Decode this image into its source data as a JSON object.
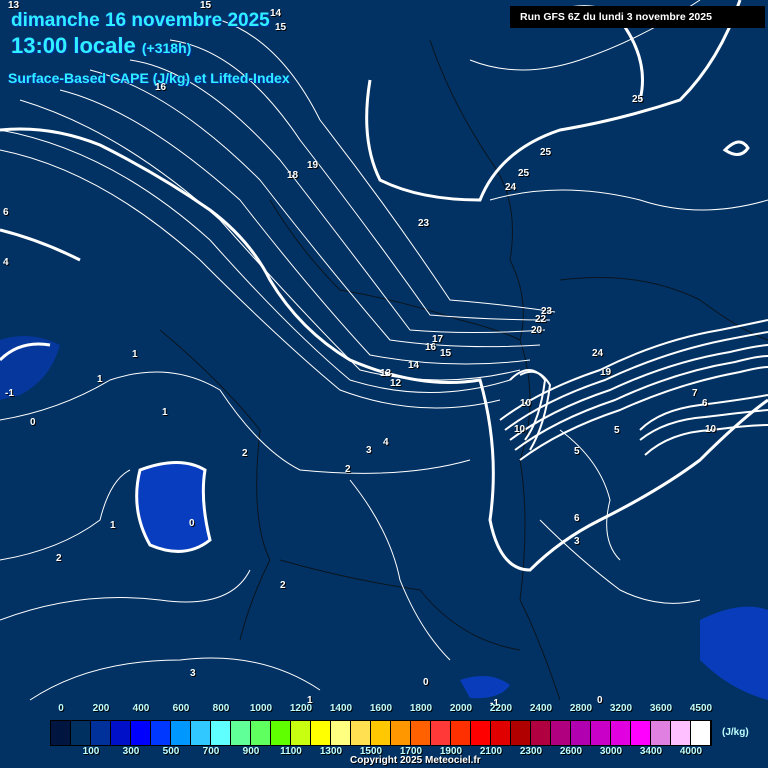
{
  "header": {
    "date": "dimanche 16 novembre 2025",
    "time": "13:00 locale",
    "offset": "(+318h)",
    "product": "Surface-Based CAPE (J/kg) et Lifted-Index",
    "run": "Run GFS 6Z du lundi 3 novembre 2025"
  },
  "legend": {
    "unit": "(J/kg)",
    "top_labels": [
      "0",
      "200",
      "400",
      "600",
      "800",
      "1000",
      "1200",
      "1400",
      "1600",
      "1800",
      "2000",
      "2200",
      "2400",
      "2800",
      "3200",
      "3600",
      "4500"
    ],
    "bottom_labels": [
      "100",
      "300",
      "500",
      "700",
      "900",
      "1100",
      "1300",
      "1500",
      "1700",
      "1900",
      "2100",
      "2300",
      "2600",
      "3000",
      "3400",
      "4000"
    ],
    "colors": [
      "#001540",
      "#003060",
      "#00309a",
      "#0010c8",
      "#0000ff",
      "#0038ff",
      "#0098ff",
      "#30c8ff",
      "#60ffff",
      "#60ff98",
      "#60ff60",
      "#60ff00",
      "#c8ff10",
      "#ffff00",
      "#ffff80",
      "#ffe050",
      "#ffc800",
      "#ff9800",
      "#ff6000",
      "#ff3838",
      "#ff3000",
      "#ff0000",
      "#e00000",
      "#b00000",
      "#b00040",
      "#b00080",
      "#b000b0",
      "#c800c8",
      "#e000e0",
      "#ff00ff",
      "#e080e0",
      "#ffc0ff",
      "#ffffff"
    ]
  },
  "copyright": "Copyright 2025 Meteociel.fr",
  "contour_labels": [
    "13",
    "14",
    "15",
    "15",
    "16",
    "19",
    "18",
    "25",
    "25",
    "24",
    "25",
    "23",
    "6",
    "4",
    "23",
    "22",
    "20",
    "17",
    "16",
    "15",
    "14",
    "13",
    "12",
    "24",
    "19",
    "1",
    "1",
    "-1",
    "0",
    "1",
    "2",
    "0",
    "10",
    "10",
    "5",
    "4",
    "3",
    "2",
    "7",
    "6",
    "5",
    "10",
    "6",
    "3",
    "1",
    "2",
    "3",
    "2",
    "0",
    "-1",
    "0",
    "1"
  ]
}
